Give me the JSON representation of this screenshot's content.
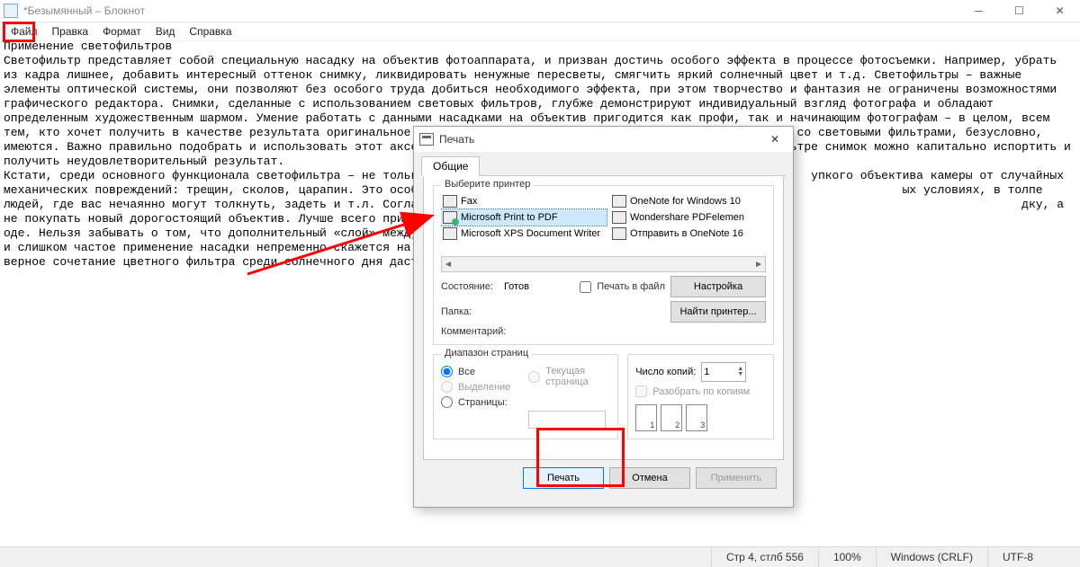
{
  "window": {
    "title": "*Безымянный – Блокнот"
  },
  "menu": {
    "items": [
      "Файл",
      "Правка",
      "Формат",
      "Вид",
      "Справка"
    ]
  },
  "document_text": "Применение светофильтров\nСветофильтр представляет собой специальную насадку на объектив фотоаппарата, и призван достичь особого эффекта в процессе фотосъемки. Например, убрать из кадра лишнее, добавить интересный оттенок снимку, ликвидировать ненужные пересветы, смягчить яркий солнечный цвет и т.д. Светофильтры – важные элементы оптической системы, они позволяют без особого труда добиться необходимого эффекта, при этом творчество и фантазия не ограничены возможностями графического редактора. Снимки, сделанные с использованием световых фильтров, глубже демонстрируют индивидуальный взгляд фотографа и обладают определенным художественным шармом. Умение работать с данными насадками на объектив пригодится как профи, так и начинающим фотографам – в целом, всем тем, кто хочет получить в качестве результата оригинальное и уникальное изображение. Однако свои нюансы в работе со световыми фильтрами, безусловно, имеются. Важно правильно подобрать и использовать этот аксессуар в дальнейшем: при неудачно подобранном светофильтре снимок можно капитально испортить и получить неудовлетворительный результат.\nКстати, среди основного функционала светофильтра – не только корр                                                  упкого объектива камеры от случайных механических повреждений: трещин, сколов, царапин. Это особенно актуально, есл                                                  ых условиях, в толпе людей, где вас нечаянно могут толкнуть, задеть и т.л. Согласитесь, гораздо удобнее и выгоднее п                                                  дку, а не покупать новый дорогостоящий объектив. Лучше всего применять световые и защитные фильтры при необходимос                                                  оде. Нельзя забывать о том, что дополнительный «слой» между объективом и непосредственно объектом съемки может н                                                  и слишком частое применение насадки непременно скажется на контрастности, добавит лишние световые блики или неу                                                  верное сочетание цветного фильтра среди солнечного дня даст и вовсе непредсказуемый результат.",
  "statusbar": {
    "position": "Стр 4, стлб 556",
    "zoom": "100%",
    "line_ending": "Windows (CRLF)",
    "encoding": "UTF-8"
  },
  "print_dialog": {
    "title": "Печать",
    "tab_label": "Общие",
    "group_select_printer": "Выберите принтер",
    "printers": [
      {
        "name": "Fax",
        "icon": "fax"
      },
      {
        "name": "Microsoft Print to PDF",
        "icon": "pdf",
        "selected": true
      },
      {
        "name": "Microsoft XPS Document Writer",
        "icon": "printer"
      },
      {
        "name": "OneNote for Windows 10",
        "icon": "printer"
      },
      {
        "name": "Wondershare PDFelemen",
        "icon": "printer"
      },
      {
        "name": "Отправить в OneNote 16",
        "icon": "printer"
      }
    ],
    "state_label": "Состояние:",
    "state_value": "Готов",
    "folder_label": "Папка:",
    "comment_label": "Комментарий:",
    "print_to_file": "Печать в файл",
    "btn_settings": "Настройка",
    "btn_find_printer": "Найти принтер...",
    "group_range": "Диапазон страниц",
    "range_all": "Все",
    "range_selection": "Выделение",
    "range_pages": "Страницы:",
    "range_current": "Текущая страница",
    "copies_label": "Число копий:",
    "copies_value": "1",
    "collate": "Разобрать по копиям",
    "collate_nums": [
      "1",
      "2",
      "3"
    ],
    "btn_print": "Печать",
    "btn_cancel": "Отмена",
    "btn_apply": "Применить"
  }
}
